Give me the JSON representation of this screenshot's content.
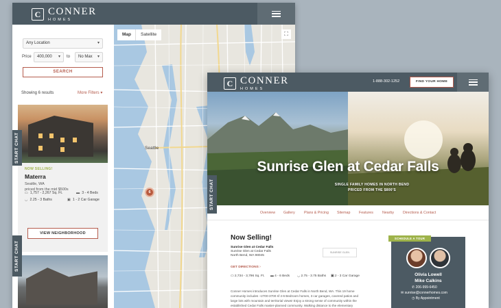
{
  "brand": {
    "mark": "C",
    "name": "CONNER",
    "sub": "HOMES"
  },
  "search": {
    "location": "Any Location",
    "price_label": "Price",
    "price_min": "400,000",
    "to_label": "to",
    "price_max": "No Max",
    "search_button": "SEARCH",
    "results_count": "Showing 6 results",
    "more_filters": "More Filters"
  },
  "listing": {
    "tag": "NOW SELLING!",
    "name": "Materra",
    "location": "Seattle, WA",
    "price": "priced from the mid $500s",
    "sqft": "1,757 - 2,267 Sq. Ft.",
    "beds": "3 - 4 Beds",
    "baths": "2.25 - 3 Baths",
    "garage": "1 - 2 Car Garage",
    "view_button": "VIEW NEIGHBORHOOD"
  },
  "chat": {
    "label": "START CHAT"
  },
  "map": {
    "tab_map": "Map",
    "tab_satellite": "Satellite",
    "city_label": "Seattle",
    "pin_count": "6"
  },
  "community": {
    "phone": "1-888-302-1252",
    "find_button": "FIND YOUR HOME",
    "hero_title": "Sunrise Glen at Cedar Falls",
    "hero_sub1": "SINGLE FAMILY HOMES IN NORTH BEND",
    "hero_sub2": "PRICED FROM THE $800'S",
    "nav": [
      "Overview",
      "Gallery",
      "Plans & Pricing",
      "Sitemap",
      "Features",
      "Nearby",
      "Directions & Contact"
    ],
    "now_selling": "Now Selling!",
    "addr_name": "Sunrise Glen at Cedar Falls",
    "addr_line1": "Sunrise Glen at Cedar Falls",
    "addr_line2": "North Bend, WA 98045",
    "get_directions": "GET DIRECTIONS",
    "brand_box": "SUNRISE GLEN",
    "specs": [
      "2,734 - 3,796 Sq. Ft.",
      "4 - 6 Beds",
      "2.75 - 3.75 Baths",
      "2 - 3 Car Garage"
    ],
    "para_lines": [
      "Conner Homes introduces Sunrise Glen at Cedar Falls in North Bend, WA. This 19 home",
      "community includes ~2700-3700 sf 4-6 Bedroom homes, 3 car garages, covered patios and",
      "large lots with mountain and territorial views! Enjoy a strong sense of community within the",
      "established Cedar Falls master-planned community. Walking distance to the elementary"
    ],
    "tour_tag": "SCHEDULE A TOUR",
    "agents": "Olivia Lowell",
    "agents2": "Mike Calkins",
    "agent_phone": "206-999-6450",
    "agent_email": "sunrise@connerhomes.com",
    "appointment": "By Appointment"
  }
}
